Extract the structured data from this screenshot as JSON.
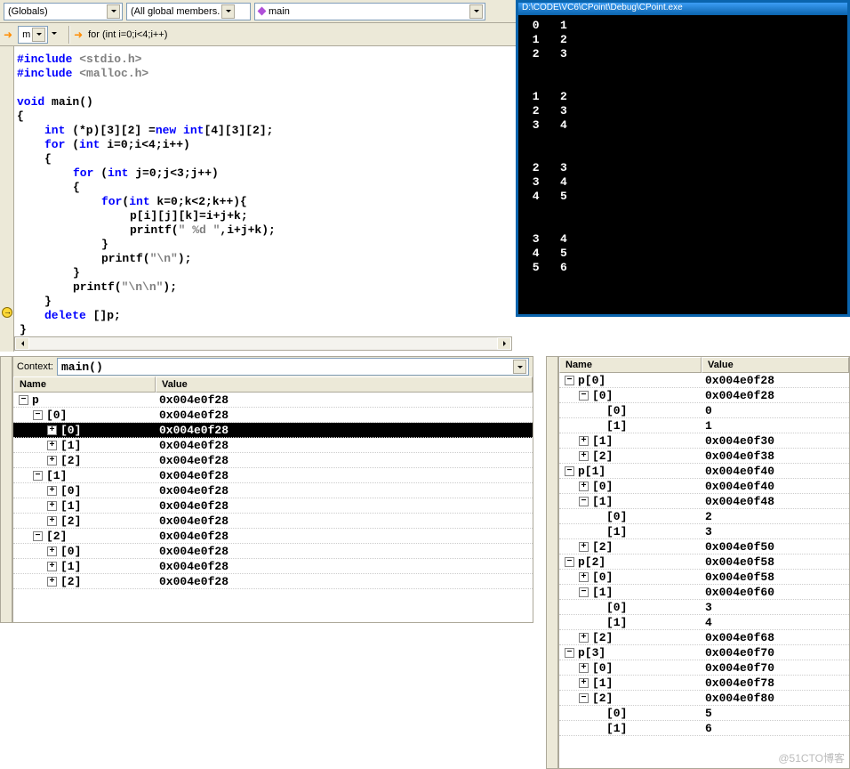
{
  "toolbar1": {
    "dd1": "(Globals)",
    "dd2": "(All global members.",
    "func": "main"
  },
  "toolbar2": {
    "dd": "m",
    "nav": "for (int i=0;i<4;i++)"
  },
  "code": {
    "l1a": "#include",
    "l1b": " <stdio.h>",
    "l2a": "#include",
    "l2b": " <malloc.h>",
    "l4a": "void",
    "l4b": " main()",
    "l5": "{",
    "l6a": "int",
    "l6b": " (*p)[3][2] =",
    "l6c": "new",
    "l6d": " ",
    "l6e": "int",
    "l6f": "[4][3][2];",
    "l7a": "for",
    "l7b": " (",
    "l7c": "int",
    "l7d": " i=0;i<4;i++)",
    "l8": "{",
    "l9a": "for",
    "l9b": " (",
    "l9c": "int",
    "l9d": " j=0;j<3;j++)",
    "l10": "{",
    "l11a": "for",
    "l11b": "(",
    "l11c": "int",
    "l11d": " k=0;k<2;k++){",
    "l12": "p[i][j][k]=i+j+k;",
    "l13a": "printf(",
    "l13b": "\" %d \"",
    "l13c": ",i+j+k);",
    "l14": "}",
    "l15a": "printf(",
    "l15b": "\"\\n\"",
    "l15c": ");",
    "l16": "}",
    "l17a": "printf(",
    "l17b": "\"\\n\\n\"",
    "l17c": ");",
    "l18": "}",
    "l19a": "delete",
    "l19b": " []p;",
    "l20": "}"
  },
  "console": {
    "title": "D:\\CODE\\VC6\\CPoint\\Debug\\CPoint.exe",
    "out": " 0   1\n 1   2\n 2   3\n\n\n 1   2\n 2   3\n 3   4\n\n\n 2   3\n 3   4\n 4   5\n\n\n 3   4\n 4   5\n 5   6"
  },
  "leftpane": {
    "context_label": "Context:",
    "context_value": "main()",
    "hdr_name": "Name",
    "hdr_value": "Value",
    "rows": [
      {
        "ind": 0,
        "pm": "-",
        "name": "p",
        "val": "0x004e0f28",
        "sel": false
      },
      {
        "ind": 1,
        "pm": "-",
        "name": "[0]",
        "val": "0x004e0f28",
        "sel": false
      },
      {
        "ind": 2,
        "pm": "+",
        "name": "[0]",
        "val": "0x004e0f28",
        "sel": true
      },
      {
        "ind": 2,
        "pm": "+",
        "name": "[1]",
        "val": "0x004e0f28",
        "sel": false
      },
      {
        "ind": 2,
        "pm": "+",
        "name": "[2]",
        "val": "0x004e0f28",
        "sel": false
      },
      {
        "ind": 1,
        "pm": "-",
        "name": "[1]",
        "val": "0x004e0f28",
        "sel": false
      },
      {
        "ind": 2,
        "pm": "+",
        "name": "[0]",
        "val": "0x004e0f28",
        "sel": false
      },
      {
        "ind": 2,
        "pm": "+",
        "name": "[1]",
        "val": "0x004e0f28",
        "sel": false
      },
      {
        "ind": 2,
        "pm": "+",
        "name": "[2]",
        "val": "0x004e0f28",
        "sel": false
      },
      {
        "ind": 1,
        "pm": "-",
        "name": "[2]",
        "val": "0x004e0f28",
        "sel": false
      },
      {
        "ind": 2,
        "pm": "+",
        "name": "[0]",
        "val": "0x004e0f28",
        "sel": false
      },
      {
        "ind": 2,
        "pm": "+",
        "name": "[1]",
        "val": "0x004e0f28",
        "sel": false
      },
      {
        "ind": 2,
        "pm": "+",
        "name": "[2]",
        "val": "0x004e0f28",
        "sel": false
      }
    ]
  },
  "rightpane": {
    "hdr_name": "Name",
    "hdr_value": "Value",
    "rows": [
      {
        "ind": 0,
        "pm": "-",
        "name": "p[0]",
        "val": "0x004e0f28"
      },
      {
        "ind": 1,
        "pm": "-",
        "name": "[0]",
        "val": "0x004e0f28"
      },
      {
        "ind": 2,
        "pm": "",
        "name": "[0]",
        "val": "0"
      },
      {
        "ind": 2,
        "pm": "",
        "name": "[1]",
        "val": "1"
      },
      {
        "ind": 1,
        "pm": "+",
        "name": "[1]",
        "val": "0x004e0f30"
      },
      {
        "ind": 1,
        "pm": "+",
        "name": "[2]",
        "val": "0x004e0f38"
      },
      {
        "ind": 0,
        "pm": "-",
        "name": "p[1]",
        "val": "0x004e0f40"
      },
      {
        "ind": 1,
        "pm": "+",
        "name": "[0]",
        "val": "0x004e0f40"
      },
      {
        "ind": 1,
        "pm": "-",
        "name": "[1]",
        "val": "0x004e0f48"
      },
      {
        "ind": 2,
        "pm": "",
        "name": "[0]",
        "val": "2"
      },
      {
        "ind": 2,
        "pm": "",
        "name": "[1]",
        "val": "3"
      },
      {
        "ind": 1,
        "pm": "+",
        "name": "[2]",
        "val": "0x004e0f50"
      },
      {
        "ind": 0,
        "pm": "-",
        "name": "p[2]",
        "val": "0x004e0f58"
      },
      {
        "ind": 1,
        "pm": "+",
        "name": "[0]",
        "val": "0x004e0f58"
      },
      {
        "ind": 1,
        "pm": "-",
        "name": "[1]",
        "val": "0x004e0f60"
      },
      {
        "ind": 2,
        "pm": "",
        "name": "[0]",
        "val": "3"
      },
      {
        "ind": 2,
        "pm": "",
        "name": "[1]",
        "val": "4"
      },
      {
        "ind": 1,
        "pm": "+",
        "name": "[2]",
        "val": "0x004e0f68"
      },
      {
        "ind": 0,
        "pm": "-",
        "name": "p[3]",
        "val": "0x004e0f70"
      },
      {
        "ind": 1,
        "pm": "+",
        "name": "[0]",
        "val": "0x004e0f70"
      },
      {
        "ind": 1,
        "pm": "+",
        "name": "[1]",
        "val": "0x004e0f78"
      },
      {
        "ind": 1,
        "pm": "-",
        "name": "[2]",
        "val": "0x004e0f80"
      },
      {
        "ind": 2,
        "pm": "",
        "name": "[0]",
        "val": "5"
      },
      {
        "ind": 2,
        "pm": "",
        "name": "[1]",
        "val": "6"
      }
    ]
  },
  "watermark": "@51CTO博客"
}
